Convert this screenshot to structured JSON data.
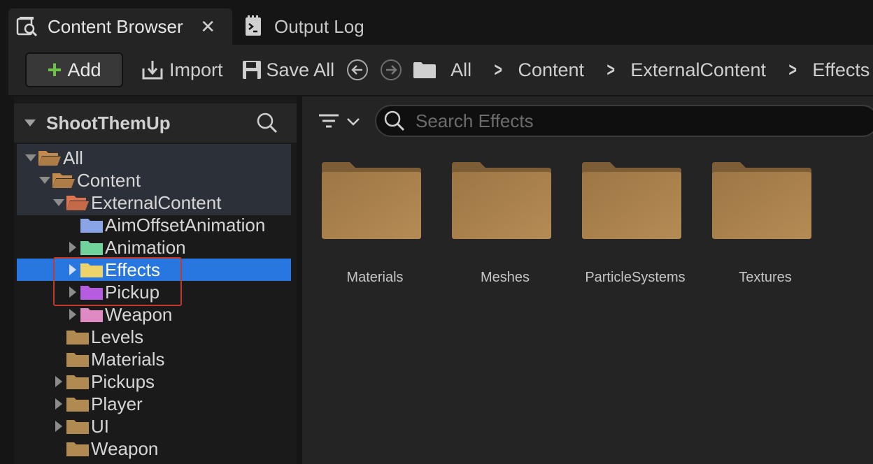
{
  "tabs": [
    {
      "label": "Content Browser",
      "active": true,
      "icon": "content-browser-icon"
    },
    {
      "label": "Output Log",
      "active": false,
      "icon": "output-log-icon"
    }
  ],
  "tab_close": "✕",
  "toolbar": {
    "add_label": "Add",
    "import_label": "Import",
    "save_all_label": "Save All",
    "breadcrumbs": [
      "All",
      "Content",
      "ExternalContent",
      "Effects"
    ]
  },
  "sources": {
    "project_name": "ShootThemUp"
  },
  "tree": [
    {
      "label": "All",
      "arrow": "down",
      "color": "#c48a4a",
      "open": true,
      "depth": 0
    },
    {
      "label": "Content",
      "arrow": "down",
      "color": "#c48a4a",
      "open": true,
      "depth": 1
    },
    {
      "label": "ExternalContent",
      "arrow": "down",
      "color": "#e0744c",
      "open": true,
      "depth": 2
    },
    {
      "label": "AimOffsetAnimation",
      "arrow": "none",
      "color": "#8aa4e8",
      "open": false,
      "depth": 3
    },
    {
      "label": "Animation",
      "arrow": "right",
      "color": "#6fd39b",
      "open": false,
      "depth": 3
    },
    {
      "label": "Effects",
      "arrow": "right",
      "color": "#ecd36a",
      "open": false,
      "depth": 3,
      "selected": true
    },
    {
      "label": "Pickup",
      "arrow": "right",
      "color": "#b65ce0",
      "open": false,
      "depth": 3
    },
    {
      "label": "Weapon",
      "arrow": "right",
      "color": "#e08ac4",
      "open": false,
      "depth": 3
    },
    {
      "label": "Levels",
      "arrow": "none",
      "color": "#b08a50",
      "open": false,
      "depth": 2
    },
    {
      "label": "Materials",
      "arrow": "none",
      "color": "#b08a50",
      "open": false,
      "depth": 2
    },
    {
      "label": "Pickups",
      "arrow": "right",
      "color": "#b08a50",
      "open": false,
      "depth": 2
    },
    {
      "label": "Player",
      "arrow": "right",
      "color": "#b08a50",
      "open": false,
      "depth": 2
    },
    {
      "label": "UI",
      "arrow": "right",
      "color": "#b08a50",
      "open": false,
      "depth": 2
    },
    {
      "label": "Weapon",
      "arrow": "none",
      "color": "#b08a50",
      "open": false,
      "depth": 2
    }
  ],
  "search": {
    "placeholder": "Search Effects"
  },
  "assets": [
    {
      "label": "Materials"
    },
    {
      "label": "Meshes"
    },
    {
      "label": "ParticleSystems"
    },
    {
      "label": "Textures"
    }
  ],
  "colors": {
    "selection": "#2876e0",
    "annotation": "#c0392b",
    "folder": "#a37a47",
    "add_plus": "#6ec24a"
  }
}
